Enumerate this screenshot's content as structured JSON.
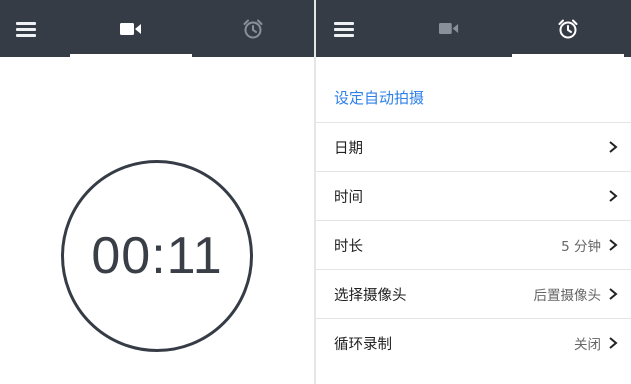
{
  "left_screen": {
    "tabs": [
      {
        "name": "menu",
        "icon": "menu-icon"
      },
      {
        "name": "video",
        "icon": "video-camera-icon",
        "active": true
      },
      {
        "name": "alarm",
        "icon": "alarm-clock-icon"
      }
    ],
    "timer": "00:11"
  },
  "right_screen": {
    "tabs": [
      {
        "name": "menu",
        "icon": "menu-icon"
      },
      {
        "name": "video",
        "icon": "video-camera-icon"
      },
      {
        "name": "alarm",
        "icon": "alarm-clock-icon",
        "active": true
      }
    ],
    "section_title": "设定自动拍摄",
    "settings": [
      {
        "label": "日期",
        "value": ""
      },
      {
        "label": "时间",
        "value": ""
      },
      {
        "label": "时长",
        "value": "5 分钟"
      },
      {
        "label": "选择摄像头",
        "value": "后置摄像头"
      },
      {
        "label": "循环录制",
        "value": "关闭"
      }
    ]
  },
  "colors": {
    "topbar": "#363c46",
    "accent_blue": "#2f80e8",
    "icon_active": "#ffffff",
    "icon_inactive": "#8a9099"
  }
}
